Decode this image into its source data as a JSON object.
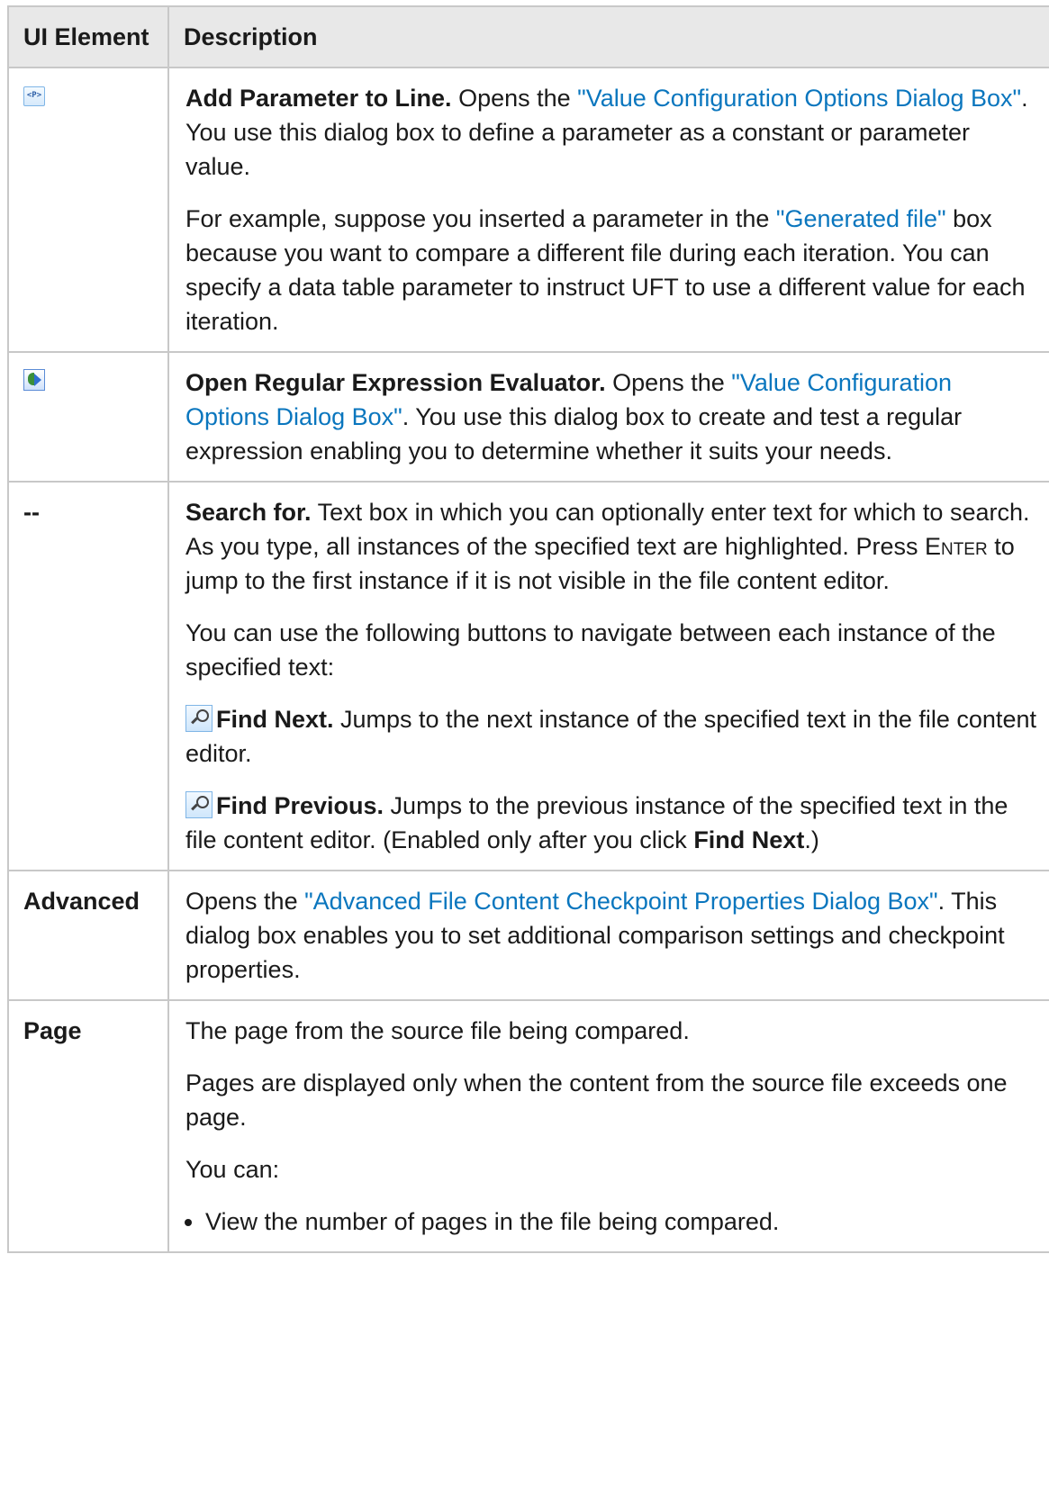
{
  "table": {
    "header": {
      "col1": "UI Element",
      "col2": "Description"
    },
    "rows": {
      "add_param": {
        "title": "Add Parameter to Line.",
        "p1_pre": " Opens the ",
        "p1_link": "\"Value Configuration Options Dialog Box\"",
        "p1_post": ". You use this dialog box to define a parameter as a constant or parameter value.",
        "p2_pre": "For example, suppose you inserted a parameter in the ",
        "p2_link": "\"Generated file\"",
        "p2_post": " box because you want to compare a different file during each iteration. You can specify a data table parameter to instruct UFT to use a different value for each iteration.",
        "icon": "parameter-icon",
        "icon_text": "<P>"
      },
      "regex": {
        "title": "Open Regular Expression Evaluator.",
        "p1_pre": " Opens the ",
        "p1_link": "\"Value Configuration Options Dialog Box\"",
        "p1_post": ". You use this dialog box to create and test a regular expression enabling you to determine whether it suits your needs.",
        "icon": "regex-evaluator-icon"
      },
      "search": {
        "element": "--",
        "title": "Search for.",
        "p1_pre": " Text box in which you can optionally enter text for which to search. As you type, all instances of the specified text are highlighted. Press ",
        "p1_key": "Enter",
        "p1_post": " to jump to the first instance if it is not visible in the file content editor.",
        "p2": "You can use the following buttons to navigate between each instance of the specified text:",
        "find_next_title": "Find Next.",
        "find_next_desc": " Jumps to the next instance of the specified text in the file content editor.",
        "find_prev_title": "Find Previous.",
        "find_prev_desc": " Jumps to the previous instance of the specified text in the file content editor. (Enabled only after you click ",
        "find_prev_bold": "Find Next",
        "find_prev_end": ".)"
      },
      "advanced": {
        "element": "Advanced",
        "p1_pre": "Opens the ",
        "p1_link": "\"Advanced File Content Checkpoint Properties Dialog Box\"",
        "p1_post": ". This dialog box enables you to set additional comparison settings and checkpoint properties."
      },
      "page": {
        "element": "Page",
        "p1": "The page from the source file being compared.",
        "p2": "Pages are displayed only when the content from the source file exceeds one page.",
        "p3": "You can:",
        "bullets": [
          "View the number of pages in the file being compared."
        ]
      }
    }
  },
  "colors": {
    "link": "#0a76be",
    "header_bg": "#e8e8e8",
    "border": "#c8c8c8"
  }
}
